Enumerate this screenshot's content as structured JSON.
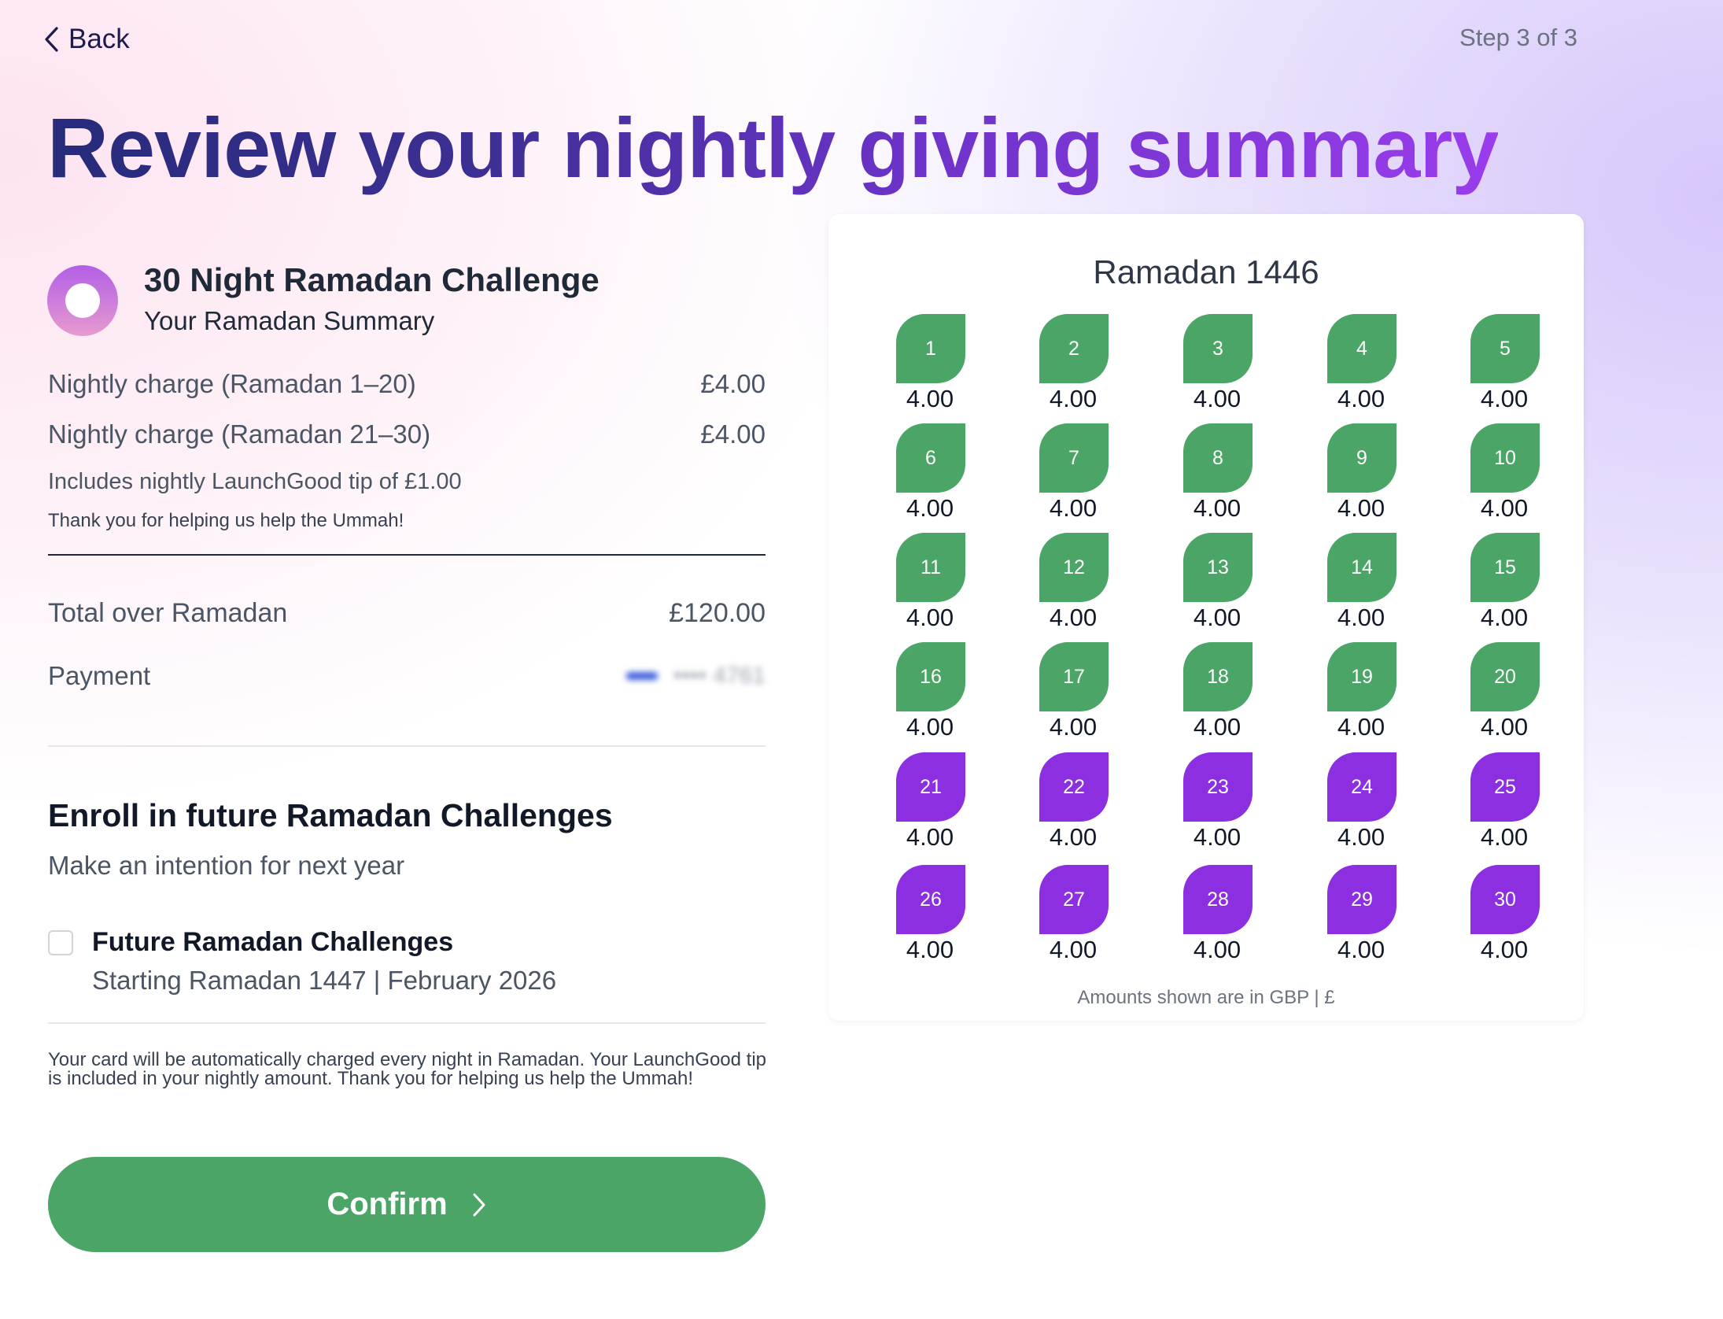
{
  "header": {
    "back_label": "Back",
    "step_label": "Step 3 of 3"
  },
  "page_title": "Review your nightly giving summary",
  "summary": {
    "challenge_title": "30 Night Ramadan Challenge",
    "challenge_subtitle": "Your Ramadan Summary",
    "rows": [
      {
        "label": "Nightly charge (Ramadan 1–20)",
        "value": "£4.00"
      },
      {
        "label": "Nightly charge (Ramadan 21–30)",
        "value": "£4.00"
      }
    ],
    "tip_note": "Includes nightly LaunchGood tip of £1.00",
    "thanks_note": "Thank you for helping us help the Ummah!",
    "total_label": "Total over Ramadan",
    "total_value": "£120.00",
    "payment_label": "Payment",
    "payment_value": "•••• 4761"
  },
  "enroll": {
    "title": "Enroll in future Ramadan Challenges",
    "subtitle": "Make an intention for next year",
    "option_title": "Future Ramadan Challenges",
    "option_subtitle": "Starting Ramadan 1447 | February 2026",
    "checked": false
  },
  "disclaimer": "Your card will be automatically charged every night in Ramadan. Your LaunchGood tip is included in your nightly amount. Thank you for helping us help the Ummah!",
  "confirm_label": "Confirm",
  "calendar": {
    "title": "Ramadan 1446",
    "note": "Amounts shown are in GBP | £",
    "colors": {
      "first_20": "#4ba566",
      "last_10": "#8b2fe0"
    },
    "nights": [
      {
        "day": "1",
        "amount": "4.00"
      },
      {
        "day": "2",
        "amount": "4.00"
      },
      {
        "day": "3",
        "amount": "4.00"
      },
      {
        "day": "4",
        "amount": "4.00"
      },
      {
        "day": "5",
        "amount": "4.00"
      },
      {
        "day": "6",
        "amount": "4.00"
      },
      {
        "day": "7",
        "amount": "4.00"
      },
      {
        "day": "8",
        "amount": "4.00"
      },
      {
        "day": "9",
        "amount": "4.00"
      },
      {
        "day": "10",
        "amount": "4.00"
      },
      {
        "day": "11",
        "amount": "4.00"
      },
      {
        "day": "12",
        "amount": "4.00"
      },
      {
        "day": "13",
        "amount": "4.00"
      },
      {
        "day": "14",
        "amount": "4.00"
      },
      {
        "day": "15",
        "amount": "4.00"
      },
      {
        "day": "16",
        "amount": "4.00"
      },
      {
        "day": "17",
        "amount": "4.00"
      },
      {
        "day": "18",
        "amount": "4.00"
      },
      {
        "day": "19",
        "amount": "4.00"
      },
      {
        "day": "20",
        "amount": "4.00"
      },
      {
        "day": "21",
        "amount": "4.00"
      },
      {
        "day": "22",
        "amount": "4.00"
      },
      {
        "day": "23",
        "amount": "4.00"
      },
      {
        "day": "24",
        "amount": "4.00"
      },
      {
        "day": "25",
        "amount": "4.00"
      },
      {
        "day": "26",
        "amount": "4.00"
      },
      {
        "day": "27",
        "amount": "4.00"
      },
      {
        "day": "28",
        "amount": "4.00"
      },
      {
        "day": "29",
        "amount": "4.00"
      },
      {
        "day": "30",
        "amount": "4.00"
      }
    ]
  }
}
